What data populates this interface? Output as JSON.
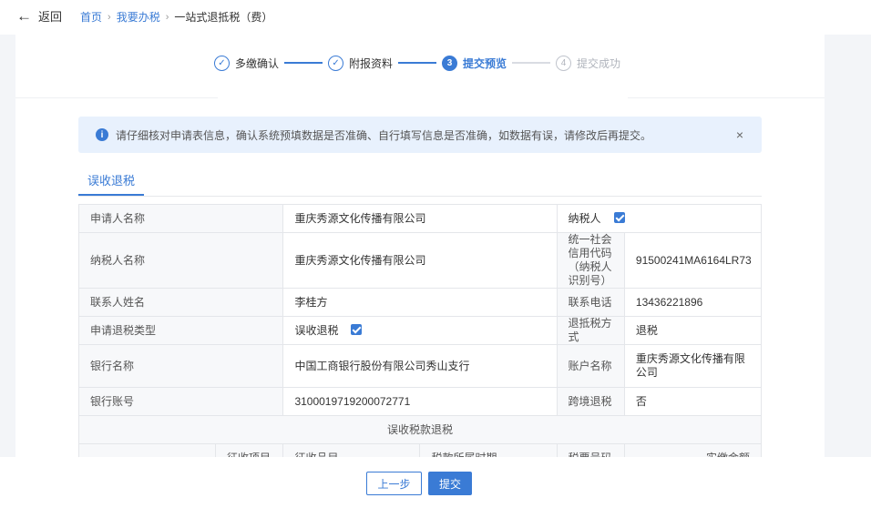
{
  "header": {
    "back_label": "返回",
    "breadcrumb": [
      "首页",
      "我要办税",
      "一站式退抵税（费）"
    ]
  },
  "steps": [
    {
      "num": "✓",
      "label": "多缴确认",
      "state": "done"
    },
    {
      "num": "✓",
      "label": "附报资料",
      "state": "done"
    },
    {
      "num": "3",
      "label": "提交预览",
      "state": "active"
    },
    {
      "num": "4",
      "label": "提交成功",
      "state": "todo"
    }
  ],
  "alert": {
    "message": "请仔细核对申请表信息，确认系统预填数据是否准确、自行填写信息是否准确，如数据有误，请修改后再提交。",
    "close": "×"
  },
  "tab": "误收退税",
  "table": {
    "applicant_name_label": "申请人名称",
    "applicant_name": "重庆秀源文化传播有限公司",
    "taxpayer_check_label": "纳税人",
    "taxpayer_name_label": "纳税人名称",
    "taxpayer_name": "重庆秀源文化传播有限公司",
    "credit_code_label": "统一社会信用代码（纳税人识别号）",
    "credit_code": "91500241MA6164LR73",
    "contact_label": "联系人姓名",
    "contact": "李桂方",
    "phone_label": "联系电话",
    "phone": "13436221896",
    "refund_type_label": "申请退税类型",
    "refund_type": "误收退税",
    "refund_method_label": "退抵税方式",
    "refund_method": "退税",
    "bank_label": "银行名称",
    "bank": "中国工商银行股份有限公司秀山支行",
    "account_name_label": "账户名称",
    "account_name": "重庆秀源文化传播有限公司",
    "account_no_label": "银行账号",
    "account_no": "3100019719200072771",
    "cross_border_label": "跨境退税",
    "cross_border": "否",
    "section_title": "误收税款退税",
    "sub_headers": [
      "",
      "征收项目",
      "征收品目",
      "税款所属时期",
      "税票号码",
      "实缴金额"
    ]
  },
  "buttons": {
    "prev": "上一步",
    "submit": "提交"
  },
  "colors": {
    "accent": "#3a7bd5",
    "alert_bg": "#e8f1fd",
    "side_gray": "#f3f5f8"
  }
}
